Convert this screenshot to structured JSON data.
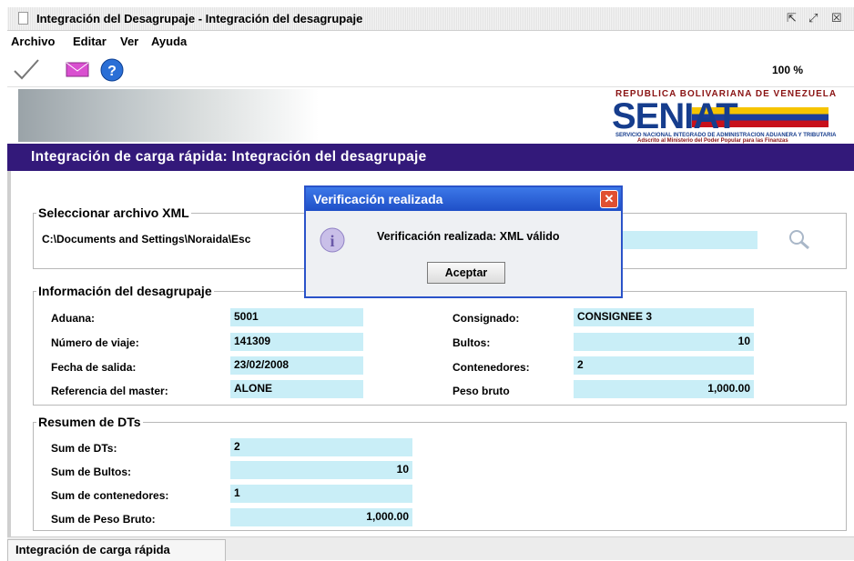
{
  "window": {
    "title": "Integración del Desagrupaje - Integración del desagrupaje"
  },
  "menu": [
    "Archivo",
    "Editar",
    "Ver",
    "Ayuda"
  ],
  "toolbar": {
    "zoom": "100 %",
    "icons": [
      "check-icon",
      "mail-icon",
      "help-icon"
    ]
  },
  "banner": {
    "republica": "REPUBLICA BOLIVARIANA DE VENEZUELA",
    "logo": "SENIAT",
    "servicio": "SERVICIO NACIONAL INTEGRADO DE ADMINISTRACION ADUANERA Y TRIBUTARIA",
    "adscrito": "Adscrito al Ministerio del Poder Popular para las Finanzas"
  },
  "header": {
    "title": "Integración de carga rápida: Integración del desagrupaje"
  },
  "xml": {
    "legend": "Seleccionar archivo XML",
    "path": "C:\\Documents and Settings\\Noraida\\Esc"
  },
  "info": {
    "legend": "Información del desagrupaje",
    "aduana_label": "Aduana:",
    "aduana": "5001",
    "viaje_label": "Número de viaje:",
    "viaje": "141309",
    "fecha_label": "Fecha de salida:",
    "fecha": "23/02/2008",
    "ref_label": "Referencia del master:",
    "ref": "ALONE",
    "consignado_label": "Consignado:",
    "consignado": "CONSIGNEE 3",
    "bultos_label": "Bultos:",
    "bultos": "10",
    "contenedores_label": "Contenedores:",
    "contenedores": "2",
    "peso_label": "Peso bruto",
    "peso": "1,000.00"
  },
  "resumen": {
    "legend": "Resumen de DTs",
    "dts_label": "Sum de DTs:",
    "dts": "2",
    "bultos_label": "Sum de Bultos:",
    "bultos": "10",
    "cont_label": "Sum de contenedores:",
    "cont": "1",
    "peso_label": "Sum de Peso Bruto:",
    "peso": "1,000.00"
  },
  "statusbar": {
    "tab": "Integración de carga rápida"
  },
  "dialog": {
    "title": "Verificación realizada",
    "message": "Verificación realizada: XML válido",
    "button": "Aceptar"
  },
  "colors": {
    "header_bg": "#33197a",
    "field_bg": "#c9eef7",
    "dialog_title": "#2a5fd9"
  }
}
